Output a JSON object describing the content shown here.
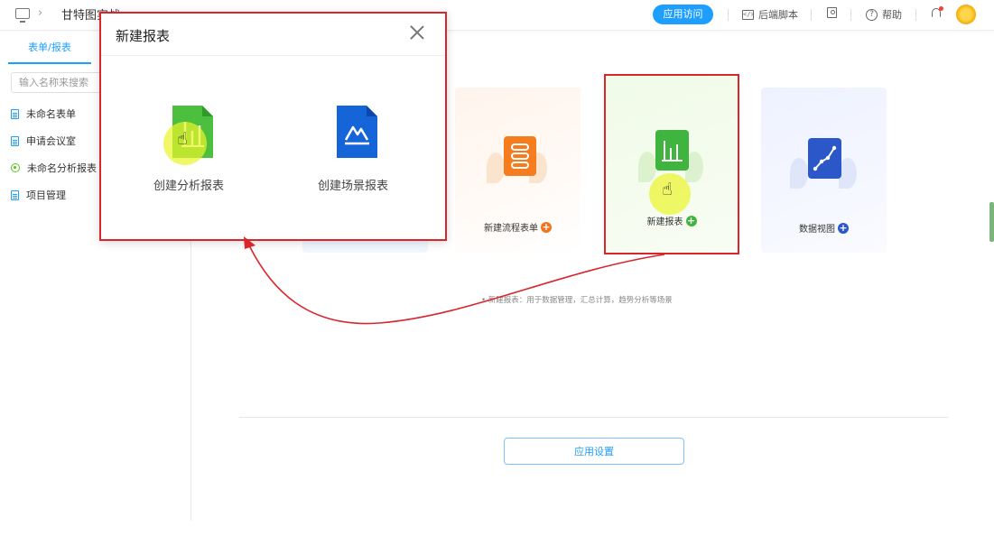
{
  "topbar": {
    "app_title": "甘特图实战",
    "visit_label": "应用访问",
    "script_label": "后端脚本",
    "help_label": "帮助"
  },
  "sidebar": {
    "tab_label": "表单/报表",
    "search_placeholder": "输入名称来搜索",
    "items": [
      {
        "label": "未命名表单",
        "icon": "doc-icon"
      },
      {
        "label": "申请会议室",
        "icon": "doc-icon"
      },
      {
        "label": "未命名分析报表",
        "icon": "report-ring-icon"
      },
      {
        "label": "项目管理",
        "icon": "doc-icon"
      }
    ]
  },
  "cards": [
    {
      "label": "新建流程表单",
      "accent": "#f0741e"
    },
    {
      "label": "新建报表",
      "accent": "#3fb53f"
    },
    {
      "label": "数据视图",
      "accent": "#2b57c9"
    }
  ],
  "hint": "• 新建报表：用于数据管理，汇总计算，趋势分析等场景",
  "settings_label": "应用设置",
  "modal": {
    "title": "新建报表",
    "options": [
      {
        "label": "创建分析报表",
        "icon": "analysis-report-icon"
      },
      {
        "label": "创建场景报表",
        "icon": "scene-report-icon"
      }
    ]
  },
  "colors": {
    "primary": "#1e9fff",
    "annotation_red": "#d9262c"
  }
}
